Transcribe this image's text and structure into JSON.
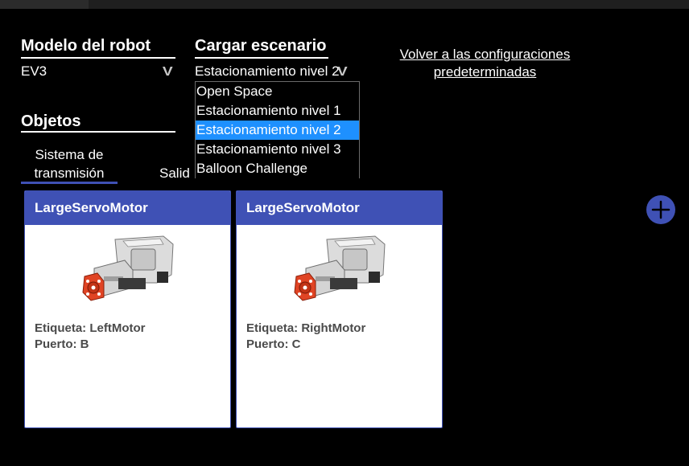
{
  "robot_model": {
    "title": "Modelo del robot",
    "value": "EV3"
  },
  "scenario": {
    "title": "Cargar escenario",
    "value": "Estacionamiento nivel 2",
    "options": [
      "Open Space",
      "Estacionamiento nivel 1",
      "Estacionamiento nivel 2",
      "Estacionamiento nivel 3",
      "Balloon Challenge"
    ],
    "selected_index": 2
  },
  "reset_link": "Volver a las configuraciones predeterminadas",
  "objects": {
    "title": "Objetos",
    "tabs": [
      {
        "label": "Sistema de transmisión",
        "active": true
      },
      {
        "label": "Salid",
        "active": false
      }
    ]
  },
  "cards": [
    {
      "title": "LargeServoMotor",
      "label_line": "Etiqueta: LeftMotor",
      "port_line": "Puerto: B"
    },
    {
      "title": "LargeServoMotor",
      "label_line": "Etiqueta: RightMotor",
      "port_line": "Puerto: C"
    }
  ],
  "colors": {
    "accent": "#3f51b5",
    "selected_option": "#1e90ff",
    "background": "#000000"
  }
}
